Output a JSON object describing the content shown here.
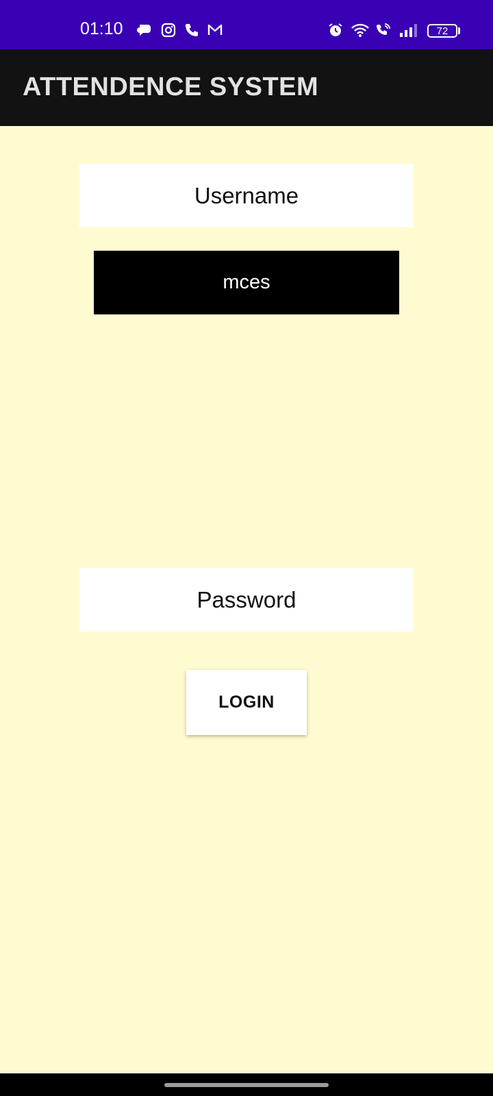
{
  "status_bar": {
    "time": "01:10",
    "battery_level": "72",
    "background": "#3a00b4",
    "left_icons": [
      "chat-bubble-icon",
      "instagram-icon",
      "phone-icon",
      "gmail-icon"
    ],
    "right_icons": [
      "alarm-icon",
      "wifi-icon",
      "wifi-call-icon",
      "signal-icon",
      "battery-icon"
    ]
  },
  "app_bar": {
    "title": "ATTENDENCE SYSTEM",
    "background": "#121212"
  },
  "form": {
    "username_label": "Username",
    "username_value": "mces",
    "password_placeholder": "Password",
    "login_label": "LOGIN"
  },
  "colors": {
    "page_background": "#fffbd1",
    "input_dark": "#000000"
  }
}
